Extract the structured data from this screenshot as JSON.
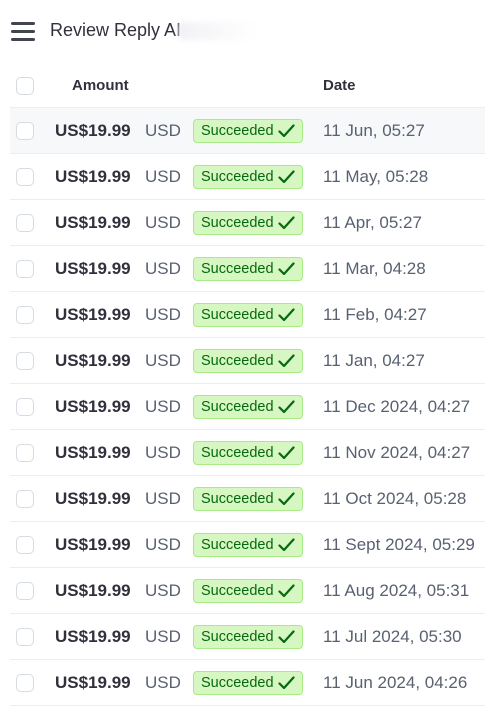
{
  "header": {
    "title": "Review Reply AI"
  },
  "table": {
    "columns": {
      "amount": "Amount",
      "date": "Date"
    },
    "rows": [
      {
        "amount": "US$19.99",
        "currency": "USD",
        "status": "Succeeded",
        "date": "11 Jun, 05:27"
      },
      {
        "amount": "US$19.99",
        "currency": "USD",
        "status": "Succeeded",
        "date": "11 May, 05:28"
      },
      {
        "amount": "US$19.99",
        "currency": "USD",
        "status": "Succeeded",
        "date": "11 Apr, 05:27"
      },
      {
        "amount": "US$19.99",
        "currency": "USD",
        "status": "Succeeded",
        "date": "11 Mar, 04:28"
      },
      {
        "amount": "US$19.99",
        "currency": "USD",
        "status": "Succeeded",
        "date": "11 Feb, 04:27"
      },
      {
        "amount": "US$19.99",
        "currency": "USD",
        "status": "Succeeded",
        "date": "11 Jan, 04:27"
      },
      {
        "amount": "US$19.99",
        "currency": "USD",
        "status": "Succeeded",
        "date": "11 Dec 2024, 04:27"
      },
      {
        "amount": "US$19.99",
        "currency": "USD",
        "status": "Succeeded",
        "date": "11 Nov 2024, 04:27"
      },
      {
        "amount": "US$19.99",
        "currency": "USD",
        "status": "Succeeded",
        "date": "11 Oct 2024, 05:28"
      },
      {
        "amount": "US$19.99",
        "currency": "USD",
        "status": "Succeeded",
        "date": "11 Sept 2024, 05:29"
      },
      {
        "amount": "US$19.99",
        "currency": "USD",
        "status": "Succeeded",
        "date": "11 Aug 2024, 05:31"
      },
      {
        "amount": "US$19.99",
        "currency": "USD",
        "status": "Succeeded",
        "date": "11 Jul 2024, 05:30"
      },
      {
        "amount": "US$19.99",
        "currency": "USD",
        "status": "Succeeded",
        "date": "11 Jun 2024, 04:26"
      }
    ]
  },
  "icons": {
    "menu": "hamburger-menu-icon",
    "status": "checkmark-icon"
  },
  "colors": {
    "badge_background": "#d7f7c2",
    "badge_border": "#a6eb84",
    "badge_text": "#05690d",
    "highlight_row": "#f6f8fa"
  }
}
